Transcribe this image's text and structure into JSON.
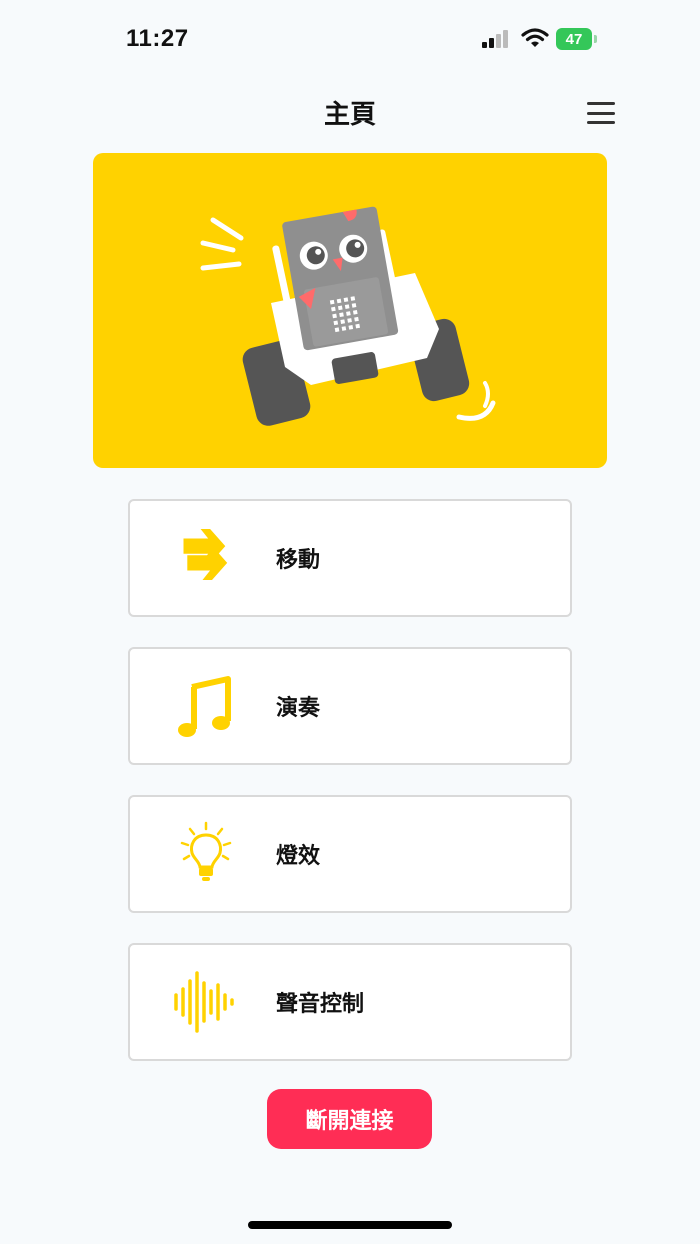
{
  "status_bar": {
    "time": "11:27",
    "battery_percent": "47",
    "battery_color": "#34c759",
    "icons": [
      "signal-icon",
      "wifi-icon",
      "battery-icon"
    ]
  },
  "header": {
    "title": "主頁",
    "menu_icon": "hamburger-menu-icon"
  },
  "hero": {
    "background": "#ffd200",
    "illustration": "robot-car-illustration"
  },
  "features": [
    {
      "label": "移動",
      "icon": "double-arrow-right-icon"
    },
    {
      "label": "演奏",
      "icon": "music-note-icon"
    },
    {
      "label": "燈效",
      "icon": "light-bulb-icon"
    },
    {
      "label": "聲音控制",
      "icon": "sound-wave-icon"
    }
  ],
  "accent_color": "#ffd200",
  "disconnect_button": {
    "label": "斷開連接",
    "color": "#ff2d55"
  }
}
